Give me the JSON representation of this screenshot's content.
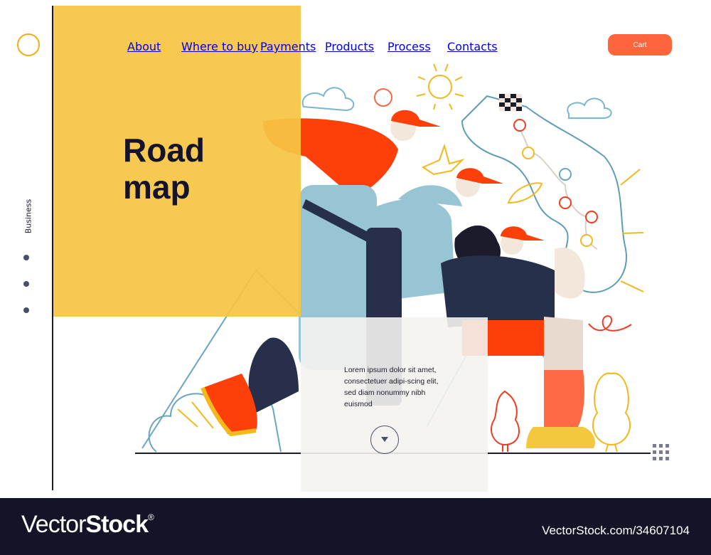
{
  "nav": {
    "items": [
      "About",
      "Where to buy",
      "Payments",
      "Products",
      "Process",
      "Contacts"
    ],
    "cart_label": "Cart"
  },
  "sidebar": {
    "label": "Business",
    "dots": 3
  },
  "hero": {
    "title_line1": "Road",
    "title_line2": "map"
  },
  "card": {
    "text": "Lorem ipsum dolor sit amet, consectetuer adipi-scing elit, sed diam nonummy nibh euismod"
  },
  "colors": {
    "accent_yellow": "#f6c544",
    "cart_orange": "#fe653d",
    "dark_navy": "#14132a",
    "logo_ring": "#f2ad1c"
  },
  "footer": {
    "brand_light": "Vector",
    "brand_bold": "Stock",
    "brand_mark": "®",
    "url": "VectorStock.com/34607104"
  }
}
